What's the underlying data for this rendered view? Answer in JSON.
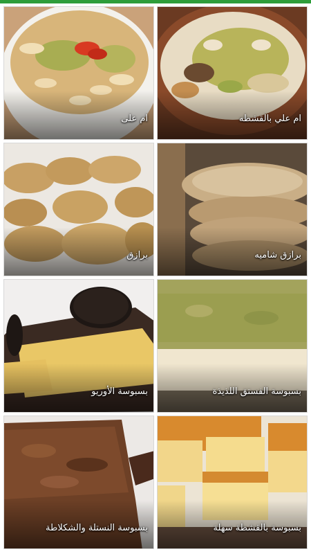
{
  "accent_color": "#2e9d3a",
  "recipes": [
    {
      "title": "ام علي بالقشطه",
      "image": "om-ali-cream-photo"
    },
    {
      "title": "ام على",
      "image": "om-ali-photo"
    },
    {
      "title": "برازق شاميه",
      "image": "shami-barazek-photo"
    },
    {
      "title": "برازق",
      "image": "barazek-photo"
    },
    {
      "title": "بسبوسة الفستق اللذيذة",
      "image": "pistachio-basbousa-photo"
    },
    {
      "title": "بسبوسة الأوريو",
      "image": "oreo-basbousa-photo"
    },
    {
      "title": "بسبوسة بالقشطة سهلة",
      "image": "cream-basbousa-photo"
    },
    {
      "title": "بسبوسة النستلة والشكلاطة",
      "image": "nestle-chocolate-basbousa-photo"
    }
  ]
}
